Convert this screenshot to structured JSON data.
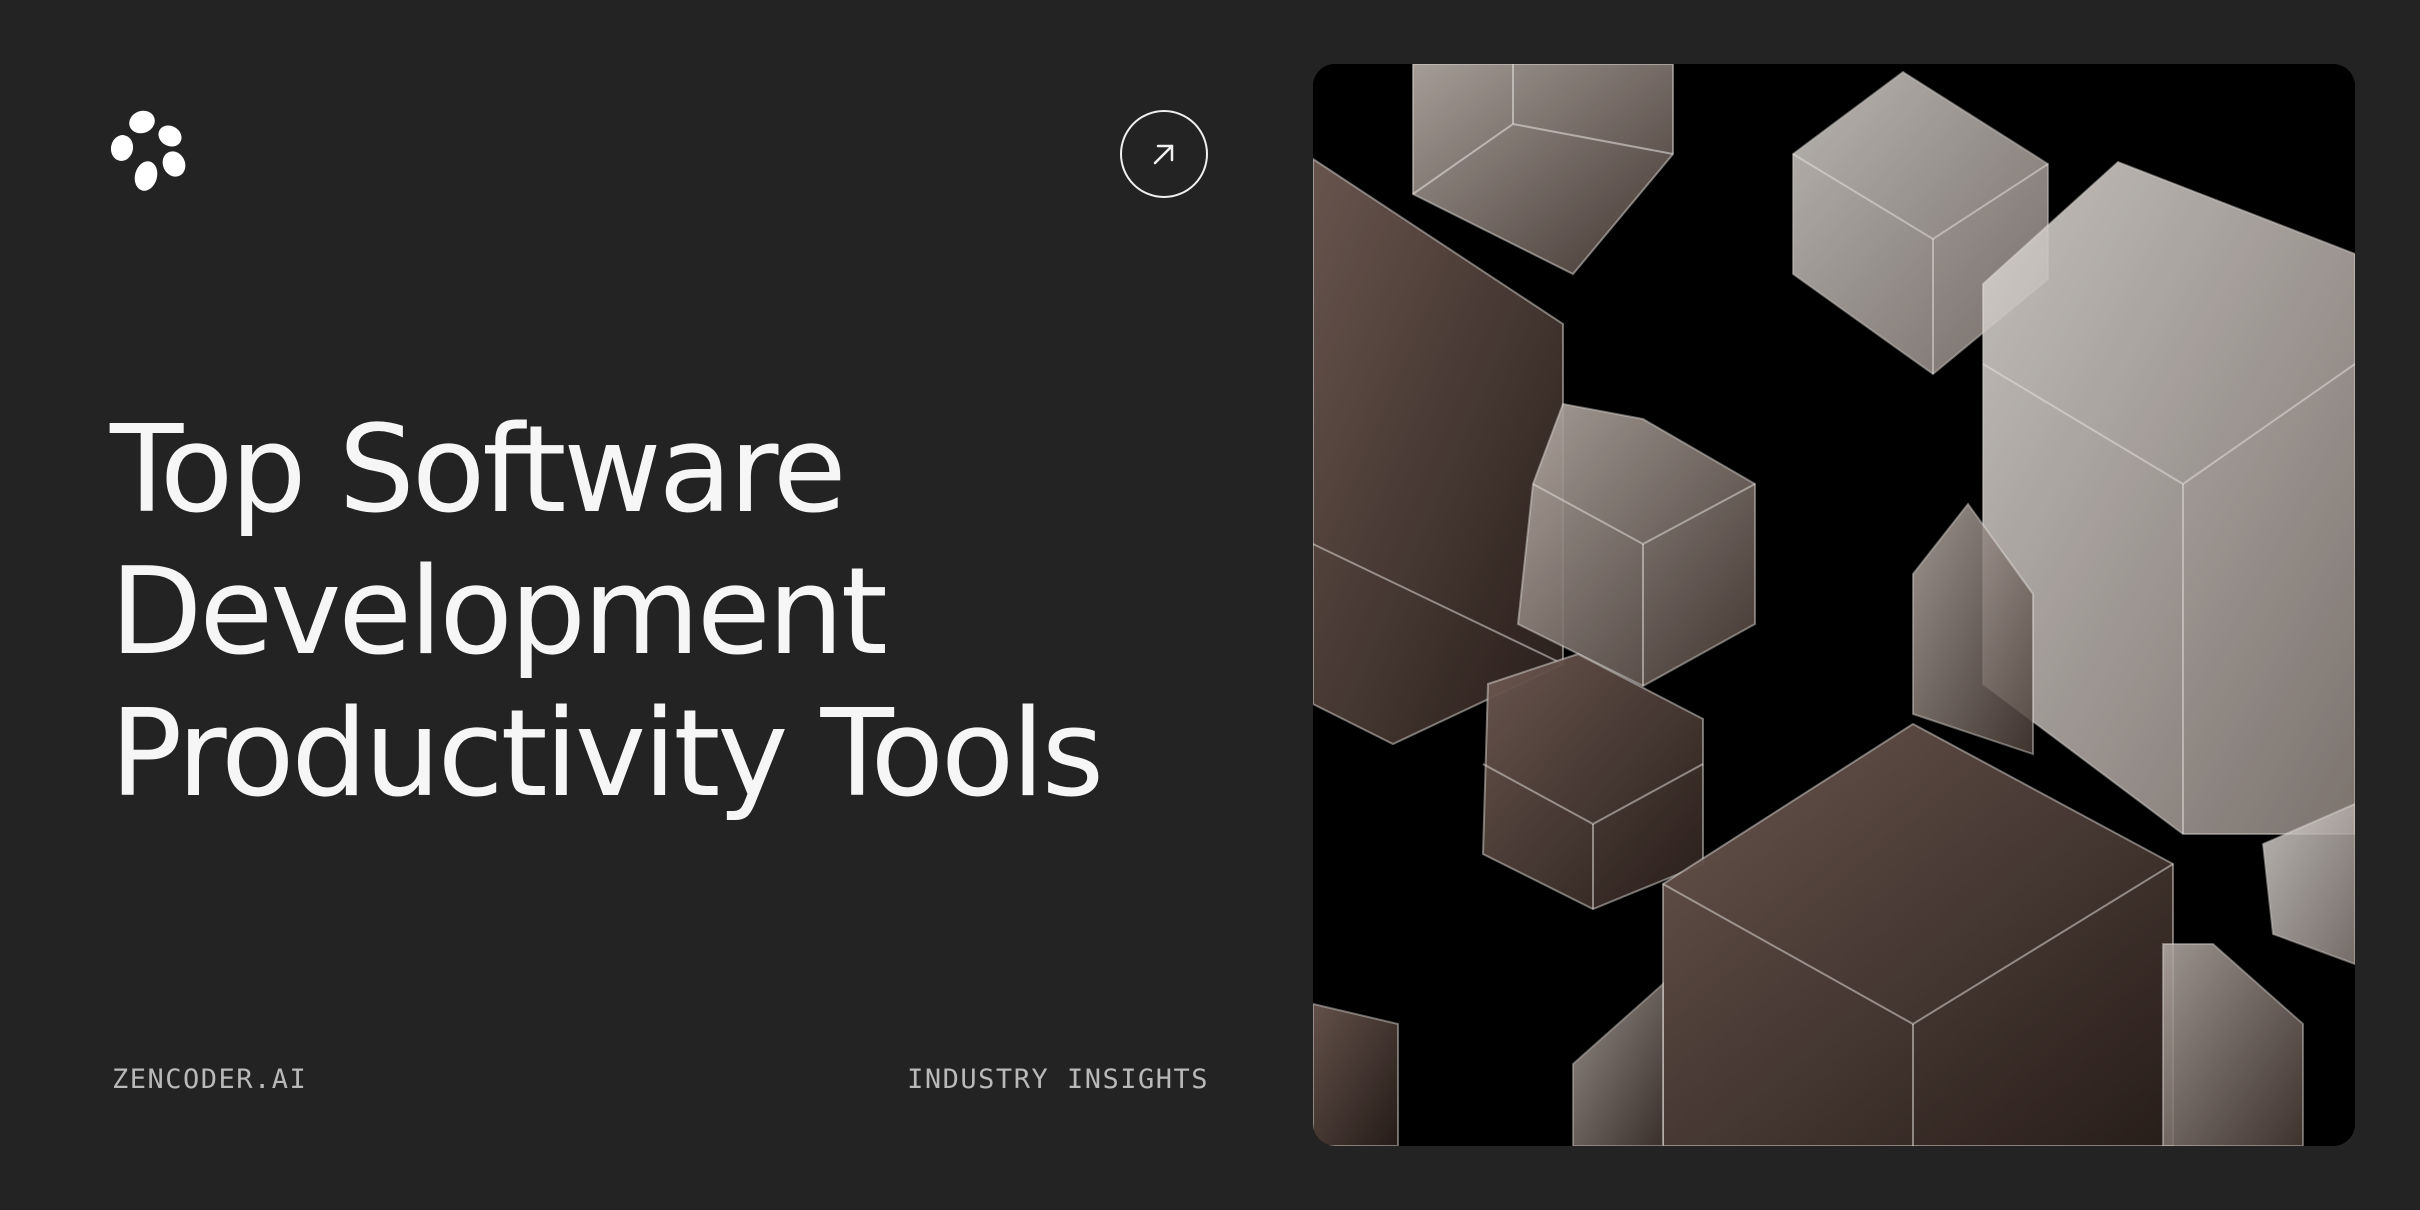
{
  "brand": {
    "logo_icon": "zencoder-logo-icon",
    "site_label": "ZENCODER.AI"
  },
  "link_button": {
    "icon": "arrow-up-right-icon"
  },
  "article": {
    "title_lines": [
      "Top Software",
      "Development",
      "Productivity Tools"
    ],
    "category": "INDUSTRY INSIGHTS"
  },
  "hero_image": {
    "subject": "glass-cubes-image"
  },
  "colors": {
    "background": "#232323",
    "text": "#f6f6f6",
    "muted_text": "#b9b9b9",
    "image_background": "#000000"
  }
}
